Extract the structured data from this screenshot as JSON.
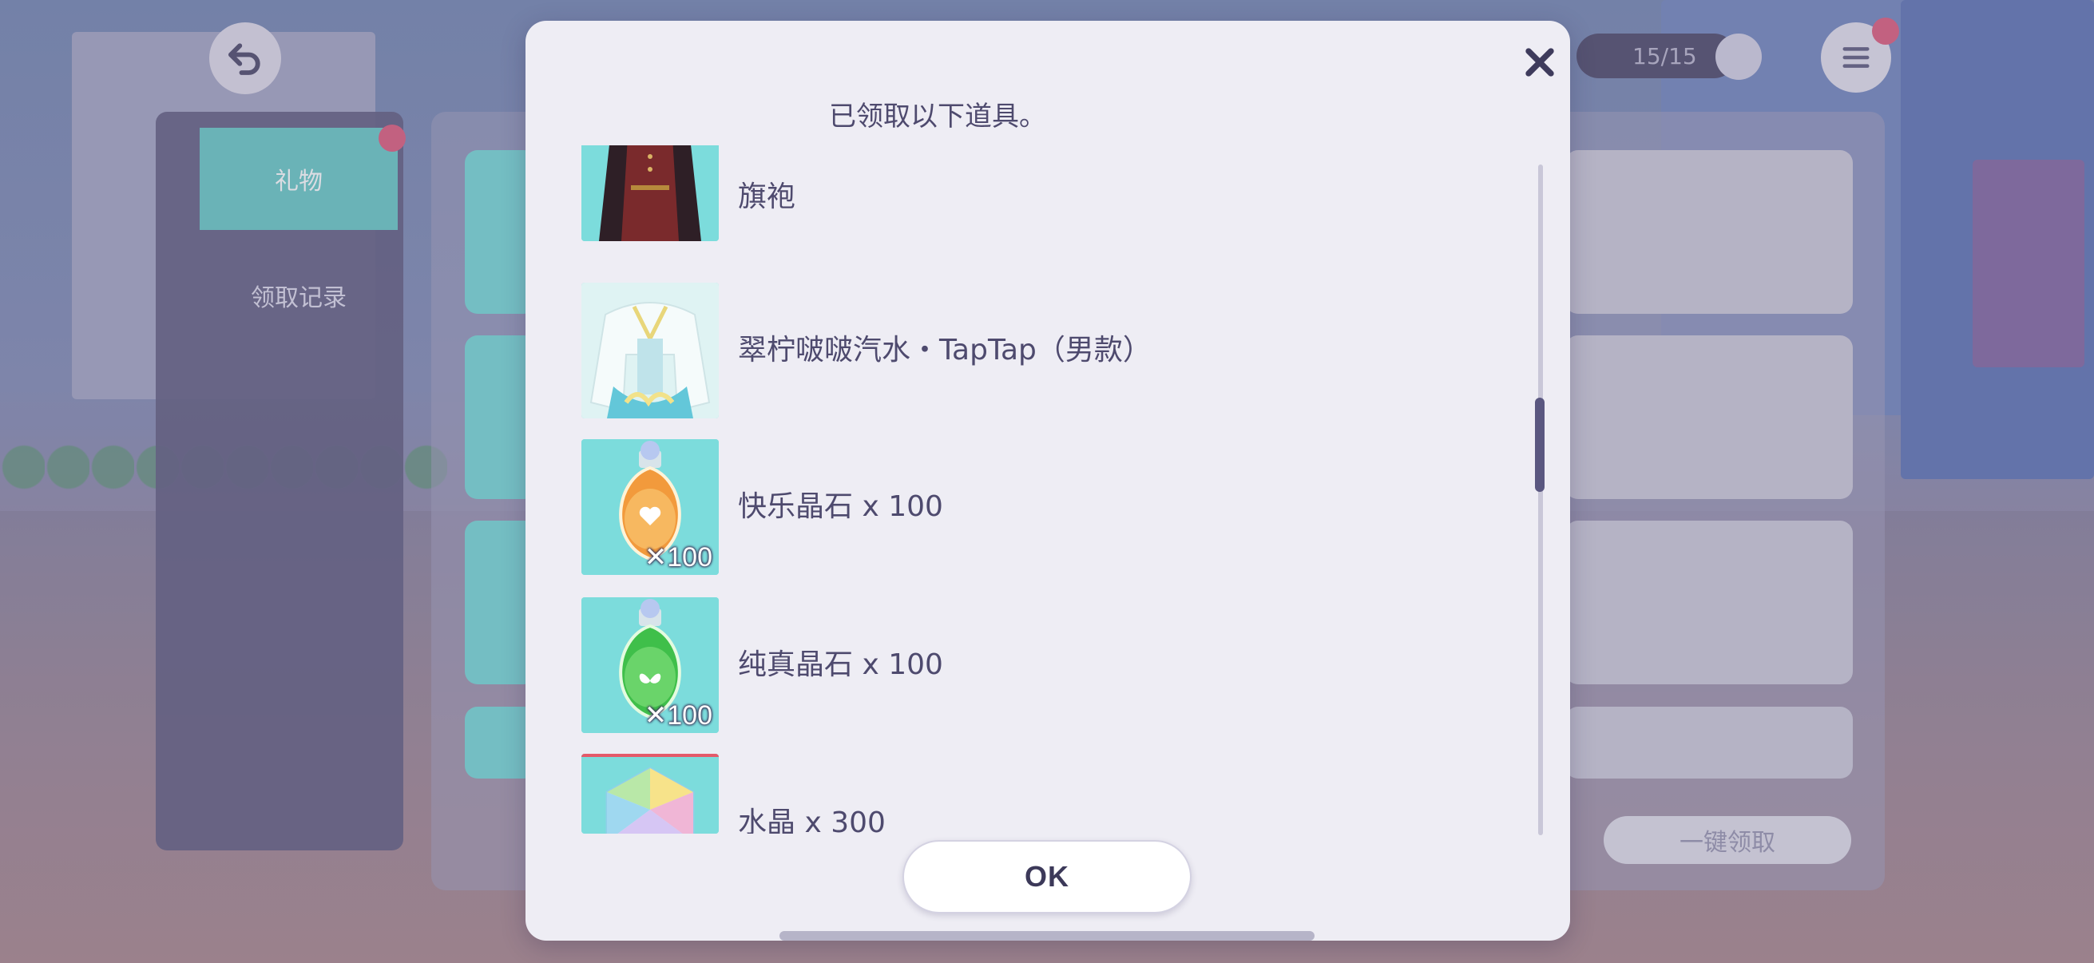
{
  "background": {
    "tabs": [
      {
        "label": "礼物"
      },
      {
        "label": "领取记录"
      }
    ],
    "stamina": {
      "value": "15/15"
    },
    "claim_all_label": "一键领取"
  },
  "modal": {
    "title": "已领取以下道具。",
    "close_icon": "close-icon",
    "items": [
      {
        "name": "旗袍",
        "icon": "qipao-outfit"
      },
      {
        "name": "翠柠啵啵汽水・TapTap（男款）",
        "icon": "soda-outfit"
      },
      {
        "name": "快乐晶石 x 100",
        "icon": "orange-crystal-bottle",
        "badge": "✕100"
      },
      {
        "name": "纯真晶石 x 100",
        "icon": "green-crystal-bottle",
        "badge": "✕100"
      },
      {
        "name": "水晶 x 300",
        "icon": "rainbow-crystal"
      }
    ],
    "ok_label": "OK"
  },
  "colors": {
    "modal_bg": "#eeedf4",
    "text": "#4e4a6e",
    "thumb_bg": "#7cdcdc",
    "badge": "#d86a88"
  }
}
